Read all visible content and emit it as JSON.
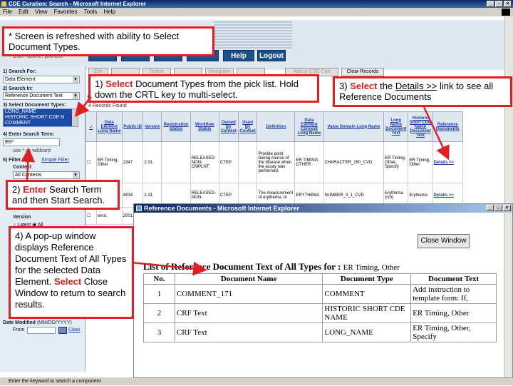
{
  "ie": {
    "title": "CDE Curation: Search - Microsoft Internet Explorer",
    "menu": [
      "File",
      "Edit",
      "View",
      "Favorites",
      "Tools",
      "Help"
    ],
    "status": "Enter the keyword to search a component"
  },
  "header": {
    "username": "User Name: pioneer",
    "help": "Help",
    "logout": "Logout"
  },
  "sidebar": {
    "search_for_label": "1) Search For:",
    "search_for_value": "Data Element",
    "search_in_label": "2) Search In:",
    "search_in_value": "Reference Document Text",
    "doc_types_label": "3) Select Document Types:",
    "doc_types": [
      "LONG_NAME",
      "HISTORIC SHORT CDE N",
      "COMMENT"
    ],
    "term_label": "4) Enter Search Term:",
    "term_value": "ER*",
    "wildcard_hint": "use * as wildcard",
    "filter_label": "5) Filter By:",
    "simple_filter": "Simple Filter",
    "context_label": "Context",
    "context_value": "All Contexts",
    "version_label": "Version",
    "version_latest": "Latest",
    "version_all": "All",
    "date_label": "Date Modified",
    "date_format": "(MM/DD/YYYY)",
    "from_label": "From",
    "clear": "Clear"
  },
  "toolbar": {
    "buttons": [
      "Edit",
      "",
      "Delete",
      "",
      "Designate",
      "",
      "Add to CDE Cart",
      "Clear Records"
    ],
    "records_found": "4 Records Found",
    "results_heading": "Se"
  },
  "results": {
    "headers": [
      "",
      "Data Element Long Name",
      "Public ID",
      "Version",
      "Registration Status",
      "Workflow Status",
      "Owned By Context",
      "Used By Context",
      "Definition",
      "Data Element Concept Long Name",
      "Value Domain Long Name",
      "Long Name Document Text",
      "Historic Short CDE Name Document Text",
      "Reference Documents"
    ],
    "rows": [
      [
        "",
        "ER Timing, Other",
        "2347",
        "2.31",
        "",
        "RELEASED-NON-CMPLNT",
        "CTEP",
        "",
        "Provide point during course of the disease when the assay was performed.",
        "ER TIMING, OTHER",
        "CHARACTER_150_CVD",
        "ER Timing, Other, Specify",
        "ER Timing, Other",
        "Details >>"
      ],
      [
        "",
        "",
        "4834",
        "2.31",
        "",
        "RELEASED-NON-",
        "CTEP",
        "",
        "The measurement of erythema, or",
        "ERYTHEMA",
        "NUMBER_3_1_CVD",
        "Erythema (cm)",
        "Erythema",
        "Details >>"
      ],
      [
        "",
        "error,",
        "2001",
        "",
        "",
        "",
        "",
        "",
        "",
        "",
        "",
        "",
        "",
        ""
      ]
    ]
  },
  "callouts": {
    "c0": "* Screen is refreshed with ability to Select Document Types.",
    "c1_red": "Select",
    "c1_num": "1)",
    "c1_text": "Document Types from the pick list. Hold down the CRTL key to multi-select.",
    "c2_num": "2)",
    "c2_red": "Enter",
    "c2_text": "Search Term and then Start Search.",
    "c3_num": "3)",
    "c3_red": "Select",
    "c3_the": "the",
    "c3_link": "Details >>",
    "c3_text": "link to see all Reference Documents",
    "c4_num": "4)",
    "c4_text": "A pop-up window displays Reference Document Text of All Types for the selected Data Element.",
    "c4_red": "Select",
    "c4_text2": "Close Window to return to search results."
  },
  "popup": {
    "title": "Reference Documents - Microsoft Internet Explorer",
    "close_button": "Close Window",
    "heading": "List of Reference Document Text of All Types for :",
    "heading_item": "ER Timing, Other",
    "columns": [
      "No.",
      "Document Name",
      "Document Type",
      "Document Text"
    ],
    "rows": [
      [
        "1",
        "COMMENT_171",
        "COMMENT",
        "Add instruction to template form: If,"
      ],
      [
        "2",
        "CRF Text",
        "HISTORIC SHORT CDE NAME",
        "ER Timing, Other"
      ],
      [
        "3",
        "CRF Text",
        "LONG_NAME",
        "ER Timing, Other, Specify"
      ]
    ]
  },
  "colors": {
    "accent_red": "#e02020",
    "nav_blue": "#1b4f8a",
    "link_blue": "#1a3ea0"
  }
}
